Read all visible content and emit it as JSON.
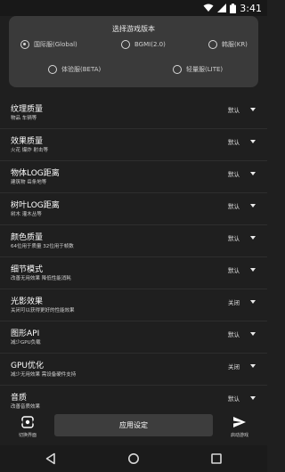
{
  "status_bar": {
    "time": "3:41",
    "icons": [
      "wifi-icon",
      "signal-icon",
      "battery-icon"
    ]
  },
  "version_selector": {
    "title": "选择游戏版本",
    "options": [
      {
        "label": "国际服(Global)",
        "checked": true
      },
      {
        "label": "BGMI(2.0)",
        "checked": false
      },
      {
        "label": "韩服(KR)",
        "checked": false
      },
      {
        "label": "体验服(BETA)",
        "checked": false
      },
      {
        "label": "轻量服(LITE)",
        "checked": false
      }
    ]
  },
  "settings": [
    {
      "title": "纹理质量",
      "subtitle": "物品 车辆等",
      "value": "默认"
    },
    {
      "title": "效果质量",
      "subtitle": "火花 爆炸 射击等",
      "value": "默认"
    },
    {
      "title": "物体LOG距离",
      "subtitle": "建筑物 岳条地等",
      "value": "默认"
    },
    {
      "title": "树叶LOG距离",
      "subtitle": "树木 灌木丛等",
      "value": "默认"
    },
    {
      "title": "颜色质量",
      "subtitle": "64位用于质量 32位用于帧数",
      "value": "默认"
    },
    {
      "title": "细节模式",
      "subtitle": "改善无用效果 降低性能消耗",
      "value": "默认"
    },
    {
      "title": "光影效果",
      "subtitle": "关闭可以获得更好的性能效果",
      "value": "关闭"
    },
    {
      "title": "图形API",
      "subtitle": "减少GPU负载",
      "value": "默认"
    },
    {
      "title": "GPU优化",
      "subtitle": "减少无用效果 需设备硬件支持",
      "value": "关闭"
    },
    {
      "title": "音质",
      "subtitle": "改善音质效果",
      "value": "默认"
    }
  ],
  "bottom_bar": {
    "left_label": "切换界面",
    "apply_label": "应用设定",
    "right_label": "启动游戏"
  },
  "nav_bar": {
    "icons": [
      "back-icon",
      "home-icon",
      "recents-icon"
    ]
  }
}
